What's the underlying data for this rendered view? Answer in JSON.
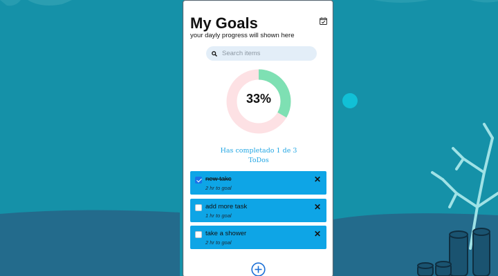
{
  "header": {
    "title": "My Goals",
    "subtitle": "your dayly progress will shown here",
    "calendar_icon": "calendar-check-icon"
  },
  "search": {
    "placeholder": "Search items",
    "value": "",
    "icon": "search-icon"
  },
  "progress": {
    "percent_label": "33%",
    "completed": 1,
    "total": 3,
    "status_line1": "Has completado 1 de 3",
    "status_line2": "ToDos",
    "colors": {
      "done": "#7ee0b3",
      "remaining": "#fde1e4"
    }
  },
  "todos": [
    {
      "name": "new takc",
      "meta": "2 hr to goal",
      "done": true
    },
    {
      "name": "add more task",
      "meta": "1 hr to goal",
      "done": false
    },
    {
      "name": "take a shower",
      "meta": "2 hr to goal",
      "done": false
    }
  ],
  "add_button": {
    "icon": "plus-circle-icon"
  },
  "colors": {
    "background": "#1591a8",
    "card": "#0ea5e6",
    "accent": "#22a6e3"
  }
}
